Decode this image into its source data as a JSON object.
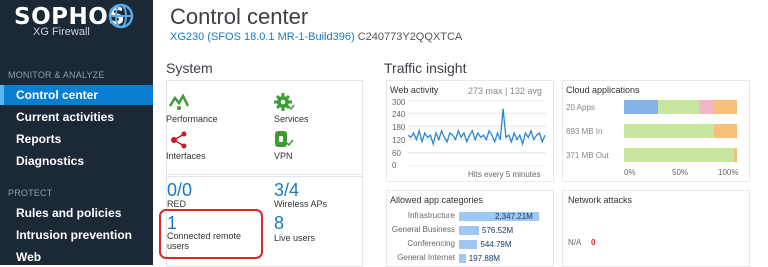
{
  "brand": {
    "logo": "SOPHOS",
    "product": "XG Firewall"
  },
  "sidebar": {
    "sections": [
      {
        "label": "MONITOR & ANALYZE"
      },
      {
        "label": "PROTECT"
      }
    ],
    "items": [
      {
        "label": "Control center",
        "active": true
      },
      {
        "label": "Current activities"
      },
      {
        "label": "Reports"
      },
      {
        "label": "Diagnostics"
      },
      {
        "label": "Rules and policies"
      },
      {
        "label": "Intrusion prevention"
      },
      {
        "label": "Web"
      }
    ]
  },
  "page": {
    "title": "Control center",
    "device_link": "XG230 (SFOS 18.0.1 MR-1-Build396)",
    "serial": "C240773Y2QQXTCA"
  },
  "system": {
    "heading": "System",
    "tiles": [
      {
        "label": "Performance",
        "icon": "performance-icon"
      },
      {
        "label": "Services",
        "icon": "services-gear-icon"
      },
      {
        "label": "Interfaces",
        "icon": "interfaces-icon"
      },
      {
        "label": "VPN",
        "icon": "vpn-lock-icon"
      }
    ],
    "stats": [
      {
        "value": "0/0",
        "label": "RED"
      },
      {
        "value": "3/4",
        "label": "Wireless APs"
      },
      {
        "value": "1",
        "label": "Connected remote users"
      },
      {
        "value": "8",
        "label": "Live users"
      }
    ]
  },
  "traffic": {
    "heading": "Traffic insight",
    "web_activity": {
      "title": "Web activity",
      "summary": "273 max | 132 avg",
      "yticks": [
        "300",
        "240",
        "180",
        "120",
        "60",
        "0"
      ],
      "caption": "Hits every 5 minutes"
    },
    "cloud_apps": {
      "title": "Cloud applications",
      "rows": [
        "20 Apps",
        "693 MB In",
        "371 MB Out"
      ],
      "xticks": [
        "0%",
        "50%",
        "100%"
      ]
    },
    "allowed_apps": {
      "title": "Allowed app categories",
      "rows": [
        {
          "name": "Infrastructure",
          "value": "2,347.21M",
          "frac": 1.0
        },
        {
          "name": "General Business",
          "value": "576.52M",
          "frac": 0.25
        },
        {
          "name": "Conferencing",
          "value": "544.79M",
          "frac": 0.23
        },
        {
          "name": "General Internet",
          "value": "197.88M",
          "frac": 0.085
        }
      ]
    },
    "network_attacks": {
      "title": "Network attacks",
      "na_label": "N/A",
      "na_value": "0"
    }
  },
  "chart_data": {
    "type": "line",
    "title": "Web activity",
    "ylim": [
      0,
      300
    ],
    "yticks": [
      0,
      60,
      120,
      180,
      240,
      300
    ],
    "values": [
      140,
      130,
      150,
      120,
      160,
      110,
      150,
      130,
      140,
      100,
      150,
      120,
      160,
      130,
      110,
      150,
      140,
      120,
      160,
      130,
      150,
      110,
      140,
      160,
      120,
      150,
      130,
      140,
      120,
      160,
      140,
      110,
      150,
      120,
      260,
      130,
      140,
      110,
      150,
      120,
      140,
      100,
      150,
      130,
      160,
      120,
      140,
      150,
      110,
      140
    ],
    "series": [
      {
        "name": "Hits every 5 minutes"
      }
    ]
  },
  "colors": {
    "sidebar": "#1b2836",
    "accent": "#0a7fd1",
    "link": "#1a78c2",
    "highlight": "#e0252b",
    "line": "#2a86d6"
  }
}
